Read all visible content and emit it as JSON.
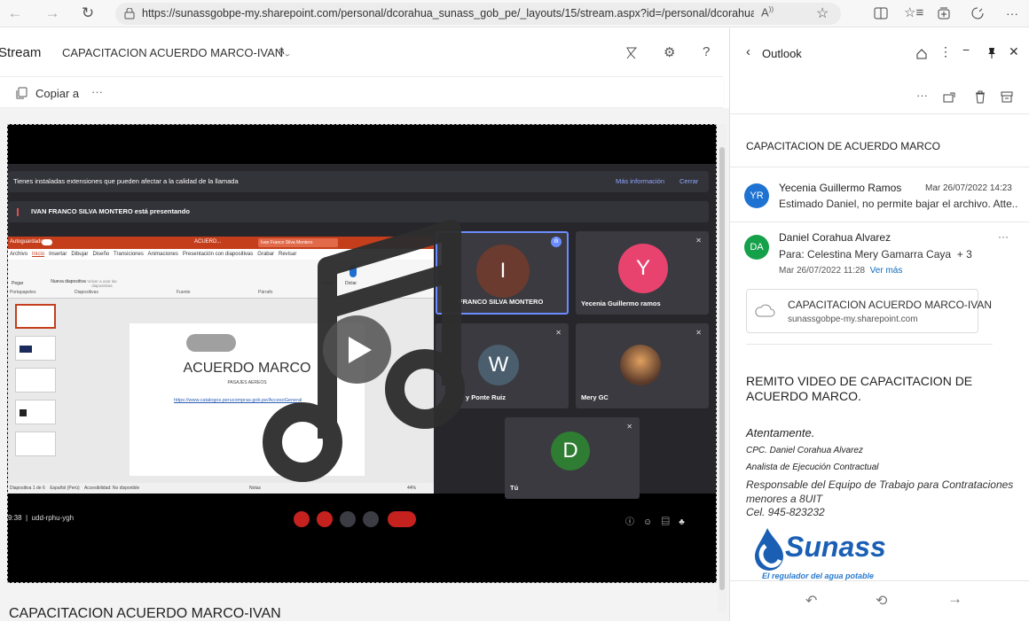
{
  "browser": {
    "url": "https://sunassgobpe-my.sharepoint.com/personal/dcorahua_sunass_gob_pe/_layouts/15/stream.aspx?id=/personal/dcorahua_suna..."
  },
  "stream": {
    "app_name": "Stream",
    "title": "CAPACITACION ACUERDO MARCO-IVAN",
    "copy_label": "Copiar a",
    "more": "···",
    "bottom_title": "CAPACITACION ACUERDO MARCO-IVAN"
  },
  "video": {
    "warning": "Tienes instaladas extensiones que pueden afectar a la calidad de la llamada",
    "more_info": "Más información",
    "close": "Cerrar",
    "presenting": "IVAN FRANCO SILVA MONTERO está presentando",
    "slide_title": "ACUERDO MARCO",
    "slide_subtitle": "PASAJES AEREOS",
    "slide_link": "https://www.catalogos.perucompras.gob.pe/AccesoGeneral",
    "ppt_status": "Diapositiva 1 de 6",
    "ppt_lang": "Español (Perú)",
    "ppt_access": "Accesibilidad: No disponible",
    "ppt_notes": "Notas",
    "ppt_zoom": "44%",
    "meeting_time": "9:38",
    "meeting_code": "udd-rphu-ygh",
    "participants": [
      {
        "initial": "I",
        "name": "FRANCO SILVA MONTERO",
        "color": "#6b3b2f"
      },
      {
        "initial": "Y",
        "name": "Yecenia Guillermo ramos",
        "color": "#e8436f"
      },
      {
        "initial": "W",
        "name": "y Ponte Ruiz",
        "color": "#4a5e6e"
      },
      {
        "initial": "",
        "name": "Mery GC",
        "color": "#5a4a3a"
      },
      {
        "initial": "D",
        "name": "Tú",
        "color": "#2e7d32"
      }
    ],
    "ribbon_tabs": [
      "Archivo",
      "Inicio",
      "Insertar",
      "Dibujar",
      "Diseño",
      "Transiciones",
      "Animaciones",
      "Presentación con diapositivas",
      "Grabar",
      "Revisar"
    ],
    "ribbon_groups": [
      "Portapapeles",
      "Diapositivas",
      "Fuente",
      "Párrafo"
    ],
    "ribbon_buttons": {
      "paste": "Pegar",
      "new_slide": "Nueva diapositiva",
      "reuse": "Volver a usar las diapositivas",
      "draw": "Dibujo",
      "dictate": "Dictar"
    },
    "autosave": "Autoguardado",
    "doc_name": "ACUERD...",
    "user_chip": "Ivan Franco Silva Montero"
  },
  "outlook": {
    "title": "Outlook",
    "subject": "CAPACITACION DE ACUERDO MARCO",
    "msg1": {
      "initials": "YR",
      "from": "Yecenia Guillermo Ramos",
      "date": "Mar 26/07/2022 14:23",
      "preview": "Estimado Daniel, no permite bajar el archivo. Atte..."
    },
    "msg2": {
      "initials": "DA",
      "from": "Daniel Corahua Alvarez",
      "to": "Para: Celestina Mery Gamarra Caya",
      "plus": "+ 3",
      "date": "Mar 26/07/2022 11:28",
      "see_more": "Ver más",
      "more": "···"
    },
    "attachment": {
      "name": "CAPACITACION ACUERDO MARCO-IVAN",
      "source": "sunassgobpe-my.sharepoint.com"
    },
    "body": {
      "line1": "REMITO VIDEO DE CAPACITACION DE ACUERDO MARCO.",
      "closing": "Atentamente.",
      "name": "CPC. Daniel Corahua Alvarez",
      "role": "Analista de Ejecución Contractual",
      "role2": "Responsable del Equipo de Trabajo para Contrataciones menores a 8UIT",
      "phone": "Cel. 945-823232",
      "logo_text": "Sunass",
      "logo_tagline": "El regulador del agua potable"
    }
  },
  "colors": {
    "accent_blue": "#0f6cbd",
    "ppt_orange": "#c43e1c",
    "sunass_blue": "#1a5fb4",
    "yr_badge": "#1e73d2",
    "da_badge": "#15a04a"
  }
}
